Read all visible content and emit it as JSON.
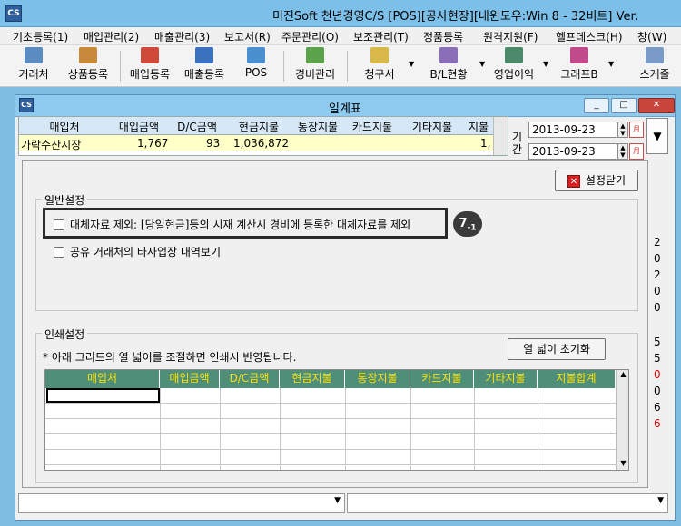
{
  "window": {
    "title": "미진Soft 천년경영C/S [POS][공사현장][내윈도우:Win 8 - 32비트] Ver.",
    "icon": "cs-app-icon"
  },
  "menu": [
    "기초등록(1)",
    "매입관리(2)",
    "매출관리(3)",
    "보고서(R)",
    "주문관리(O)",
    "보조관리(T)",
    "정품등록",
    "원격지원(F)",
    "헬프데스크(H)",
    "창(W)"
  ],
  "toolbar": [
    "거래처",
    "상품등록",
    "매입등록",
    "매출등록",
    "POS",
    "경비관리",
    "청구서",
    "B/L현황",
    "영업이익",
    "그래프B",
    "스케줄"
  ],
  "child": {
    "title": "일계표",
    "min": "_",
    "max": "□",
    "close": "✕"
  },
  "topgrid": {
    "headers": [
      "매입처",
      "매입금액",
      "D/C금액",
      "현금지불",
      "통장지불",
      "카드지불",
      "기타지불",
      "지불"
    ],
    "row": [
      "가락수산시장",
      "1,767",
      "93",
      "1,036,872",
      "",
      "",
      "",
      "1,"
    ]
  },
  "period": {
    "label": "기간",
    "from": "2013-09-23",
    "to": "2013-09-23",
    "cal": "月"
  },
  "rightnums": [
    "2",
    "0",
    "2",
    "0",
    "0",
    "5",
    "5",
    "0",
    "0",
    "6",
    "6"
  ],
  "settings": {
    "close_label": "설정닫기",
    "general_label": "일반설정",
    "opt1": "대체자료 제외: [당일현금]등의 시재 계산시 경비에 등록한 대체자료를 제외",
    "opt2": "공유 거래처의 타사업장 내역보기",
    "badge": "7",
    "badge_sub": "-1",
    "print_label": "인쇄설정",
    "print_note": "* 아래 그리드의 열 넓이를 조절하면 인쇄시 반영됩니다.",
    "reset_label": "열 넓이 초기화",
    "print_headers": [
      "매입처",
      "매입금액",
      "D/C금액",
      "현금지불",
      "통장지불",
      "카드지불",
      "기타지불",
      "지불합계"
    ]
  },
  "colors": {
    "titlebar": "#7cc0ea",
    "grid_header": "#4f8f7a",
    "grid_header_text": "#ffe000",
    "row_highlight": "#ffffc8"
  }
}
